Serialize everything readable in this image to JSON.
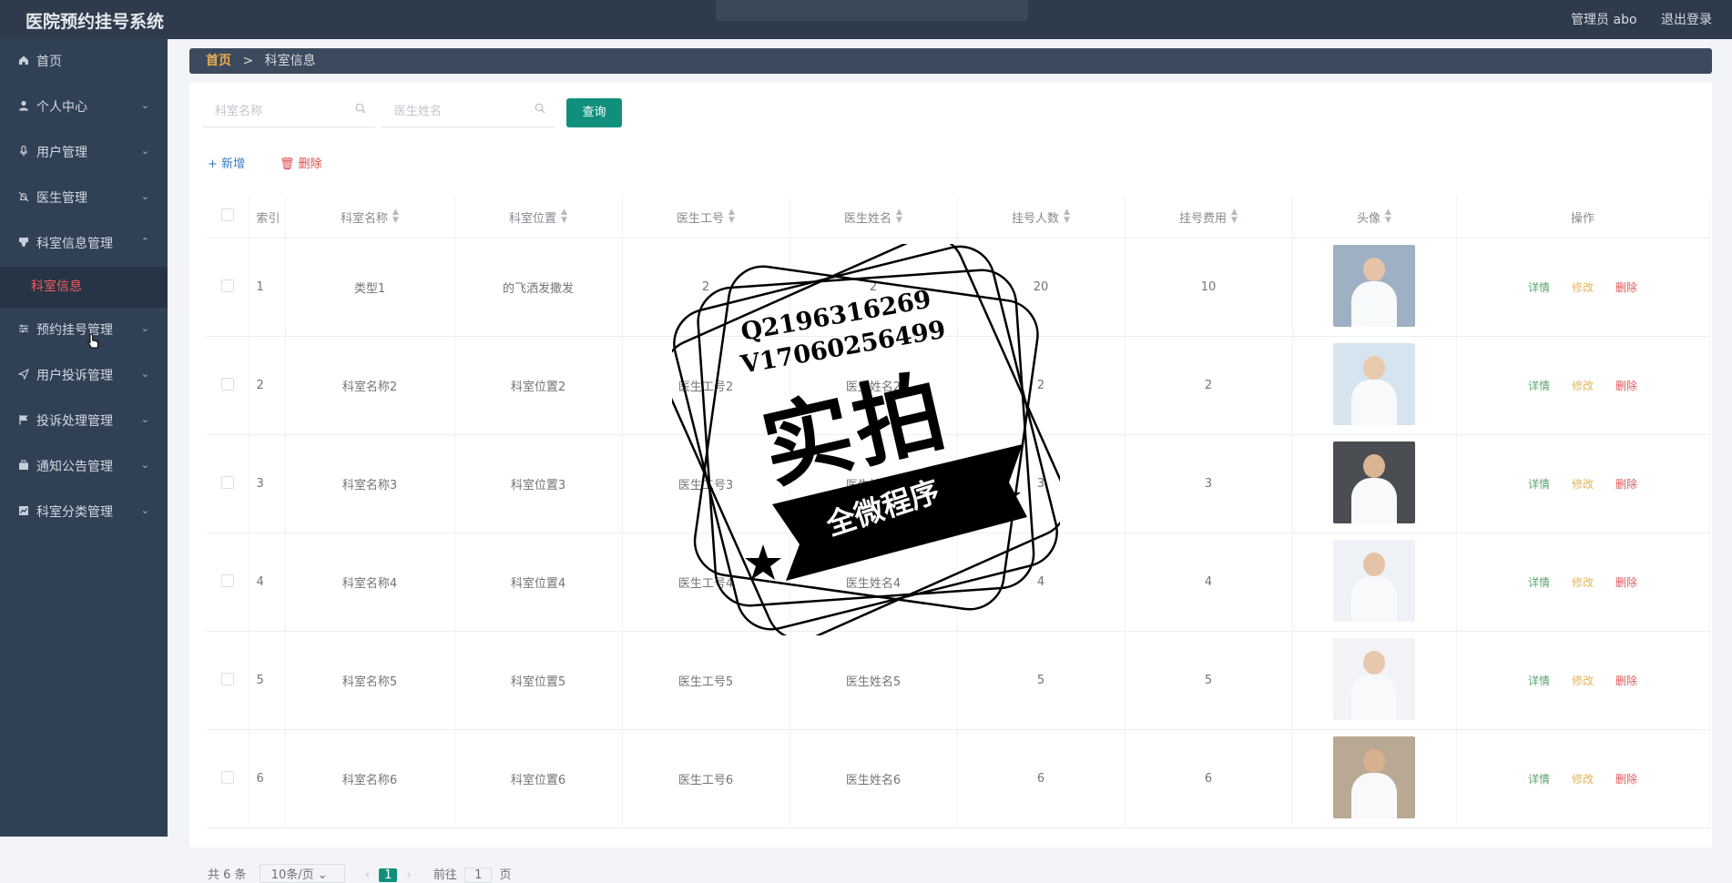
{
  "app": {
    "title": "医院预约挂号系统",
    "user_label": "管理员 abo",
    "logout_label": "退出登录"
  },
  "sidebar": {
    "items": [
      {
        "label": "首页",
        "icon": "home-icon",
        "chevron": false
      },
      {
        "label": "个人中心",
        "icon": "user-icon",
        "chevron": true
      },
      {
        "label": "用户管理",
        "icon": "mic-icon",
        "chevron": true
      },
      {
        "label": "医生管理",
        "icon": "bell-slash-icon",
        "chevron": true
      },
      {
        "label": "科室信息管理",
        "icon": "cup-icon",
        "chevron": true,
        "expanded": true,
        "children": [
          {
            "label": "科室信息",
            "active": true
          }
        ]
      },
      {
        "label": "预约挂号管理",
        "icon": "sliders-icon",
        "chevron": true
      },
      {
        "label": "用户投诉管理",
        "icon": "send-icon",
        "chevron": true
      },
      {
        "label": "投诉处理管理",
        "icon": "flag-icon",
        "chevron": true
      },
      {
        "label": "通知公告管理",
        "icon": "briefcase-icon",
        "chevron": true
      },
      {
        "label": "科室分类管理",
        "icon": "chart-icon",
        "chevron": true
      }
    ]
  },
  "breadcrumb": {
    "home": "首页",
    "separator": ">",
    "current": "科室信息"
  },
  "search": {
    "dept_name_placeholder": "科室名称",
    "doctor_name_placeholder": "医生姓名",
    "query_label": "查询"
  },
  "actions": {
    "add_label": "+ 新增",
    "delete_label": "删除"
  },
  "table": {
    "columns": [
      "索引",
      "科室名称",
      "科室位置",
      "医生工号",
      "医生姓名",
      "挂号人数",
      "挂号费用",
      "头像",
      "操作"
    ],
    "rows": [
      {
        "index": "1",
        "dept_name": "类型1",
        "location": "的飞洒发撒发",
        "doctor_no": "2",
        "doctor_name": "2",
        "count": "20",
        "fee": "10",
        "avatar_color": "#9fb0c4"
      },
      {
        "index": "2",
        "dept_name": "科室名称2",
        "location": "科室位置2",
        "doctor_no": "医生工号2",
        "doctor_name": "医生姓名2",
        "count": "2",
        "fee": "2",
        "avatar_color": "#d6e4ef"
      },
      {
        "index": "3",
        "dept_name": "科室名称3",
        "location": "科室位置3",
        "doctor_no": "医生工号3",
        "doctor_name": "医生姓名3",
        "count": "3",
        "fee": "3",
        "avatar_color": "#4a4d52"
      },
      {
        "index": "4",
        "dept_name": "科室名称4",
        "location": "科室位置4",
        "doctor_no": "医生工号4",
        "doctor_name": "医生姓名4",
        "count": "4",
        "fee": "4",
        "avatar_color": "#eef2f6"
      },
      {
        "index": "5",
        "dept_name": "科室名称5",
        "location": "科室位置5",
        "doctor_no": "医生工号5",
        "doctor_name": "医生姓名5",
        "count": "5",
        "fee": "5",
        "avatar_color": "#f1f3f6"
      },
      {
        "index": "6",
        "dept_name": "科室名称6",
        "location": "科室位置6",
        "doctor_no": "医生工号6",
        "doctor_name": "医生姓名6",
        "count": "6",
        "fee": "6",
        "avatar_color": "#b8a894"
      }
    ],
    "op_detail": "详情",
    "op_edit": "修改",
    "op_delete": "删除"
  },
  "pager": {
    "total": "共 6 条",
    "page_size": "10条/页",
    "current_page": "1",
    "goto_label": "前往",
    "goto_value": "1",
    "page_unit": "页"
  },
  "watermark": {
    "line1": "Q2196316269",
    "line2": "V17060256499",
    "main": "实拍",
    "band": "全微程序"
  },
  "colors": {
    "topbar": "#2e3b4c",
    "sidebar": "#304156",
    "accent": "#10907c",
    "active_menu": "#f05a5a"
  }
}
